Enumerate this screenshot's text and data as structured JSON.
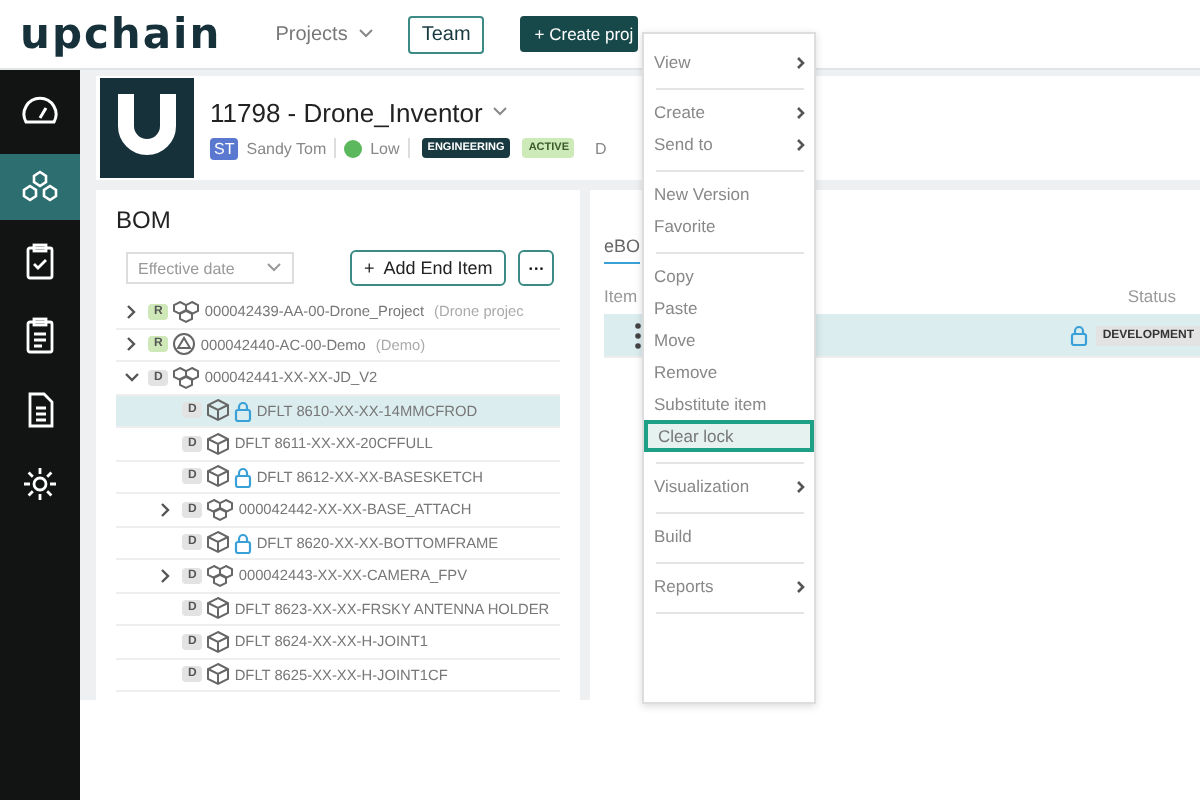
{
  "header": {
    "logo": "upchain",
    "nav": [
      {
        "label": "Projects",
        "kind": "dropdown"
      },
      {
        "label": "Team",
        "kind": "outline"
      },
      {
        "label": "Create proj",
        "kind": "primary",
        "icon": "+"
      }
    ]
  },
  "sidebar": {
    "items": [
      {
        "selected": false
      },
      {
        "selected": true
      },
      {
        "selected": false
      },
      {
        "selected": false
      },
      {
        "selected": false
      },
      {
        "selected": false
      }
    ]
  },
  "project": {
    "title": "11798 - Drone_Inventor",
    "owner_initials": "ST",
    "owner": "Sandy Tom",
    "priority": {
      "label": "Low",
      "color": "#5cb85c"
    },
    "tags": [
      {
        "label": "ENGINEERING",
        "color": "#17393f"
      },
      {
        "label": "ACTIVE",
        "color": "#cdeab9"
      }
    ],
    "extra": "D"
  },
  "bom": {
    "title": "BOM",
    "filter": {
      "placeholder": "Effective date"
    },
    "add_icon": "+",
    "add_button": "Add End Item",
    "more_button": "···",
    "rows": [
      {
        "has_children": true,
        "expanded": false,
        "badge": "R",
        "color": "#cfe8b8",
        "kind": "assembly",
        "locked": false,
        "selected": false,
        "name": "000042439-AA-00-Drone_Project",
        "note": "(Drone projec"
      },
      {
        "has_children": true,
        "expanded": false,
        "badge": "R",
        "color": "#cfe8b8",
        "kind": "sheet",
        "locked": false,
        "selected": false,
        "name": "000042440-AC-00-Demo",
        "note": "(Demo)"
      },
      {
        "has_children": true,
        "expanded": true,
        "badge": "D",
        "color": "#e3e3e3",
        "kind": "assembly",
        "locked": false,
        "selected": false,
        "name": "000042441-XX-XX-JD_V2",
        "children": [
          {
            "has_children": false,
            "badge": "D",
            "color": "#e3e3e3",
            "kind": "part",
            "locked": true,
            "selected": true,
            "name": "DFLT 8610-XX-XX-14MMCFROD"
          },
          {
            "has_children": false,
            "badge": "D",
            "color": "#e3e3e3",
            "kind": "part",
            "locked": false,
            "selected": false,
            "name": "DFLT 8611-XX-XX-20CFFULL"
          },
          {
            "has_children": false,
            "badge": "D",
            "color": "#e3e3e3",
            "kind": "part",
            "locked": true,
            "selected": false,
            "name": "DFLT 8612-XX-XX-BASESKETCH"
          },
          {
            "has_children": true,
            "expanded": false,
            "badge": "D",
            "color": "#e3e3e3",
            "kind": "assembly",
            "locked": false,
            "selected": false,
            "name": "000042442-XX-XX-BASE_ATTACH"
          },
          {
            "has_children": false,
            "badge": "D",
            "color": "#e3e3e3",
            "kind": "part",
            "locked": true,
            "selected": false,
            "name": "DFLT 8620-XX-XX-BOTTOMFRAME"
          },
          {
            "has_children": true,
            "expanded": false,
            "badge": "D",
            "color": "#e3e3e3",
            "kind": "assembly",
            "locked": false,
            "selected": false,
            "name": "000042443-XX-XX-CAMERA_FPV"
          },
          {
            "has_children": false,
            "badge": "D",
            "color": "#e3e3e3",
            "kind": "part",
            "locked": false,
            "selected": false,
            "name": "DFLT 8623-XX-XX-FRSKY ANTENNA HOLDER"
          },
          {
            "has_children": false,
            "badge": "D",
            "color": "#e3e3e3",
            "kind": "part",
            "locked": false,
            "selected": false,
            "name": "DFLT 8624-XX-XX-H-JOINT1"
          },
          {
            "has_children": false,
            "badge": "D",
            "color": "#e3e3e3",
            "kind": "part",
            "locked": false,
            "selected": false,
            "name": "DFLT 8625-XX-XX-H-JOINT1CF"
          }
        ]
      }
    ]
  },
  "ebom": {
    "tab": "eBO",
    "columns": [
      "Item",
      "Status"
    ],
    "row": {
      "selected": true,
      "locked": true,
      "status": "DEVELOPMENT"
    }
  },
  "context_menu": {
    "groups": [
      [
        {
          "label": "View",
          "submenu": true,
          "selected": false
        }
      ],
      [
        {
          "label": "Create",
          "submenu": true,
          "selected": false
        },
        {
          "label": "Send to",
          "submenu": true,
          "selected": false
        }
      ],
      [
        {
          "label": "New Version",
          "submenu": false,
          "selected": false
        },
        {
          "label": "Favorite",
          "submenu": false,
          "selected": false
        }
      ],
      [
        {
          "label": "Copy",
          "submenu": false,
          "selected": false
        },
        {
          "label": "Paste",
          "submenu": false,
          "selected": false
        },
        {
          "label": "Move",
          "submenu": false,
          "selected": false
        },
        {
          "label": "Remove",
          "submenu": false,
          "selected": false
        },
        {
          "label": "Substitute item",
          "submenu": false,
          "selected": false
        },
        {
          "label": "Clear lock",
          "submenu": false,
          "selected": true
        }
      ],
      [
        {
          "label": "Visualization",
          "submenu": true,
          "selected": false
        }
      ],
      [
        {
          "label": "Build",
          "submenu": false,
          "selected": false
        }
      ],
      [
        {
          "label": "Reports",
          "submenu": true,
          "selected": false
        }
      ]
    ]
  }
}
